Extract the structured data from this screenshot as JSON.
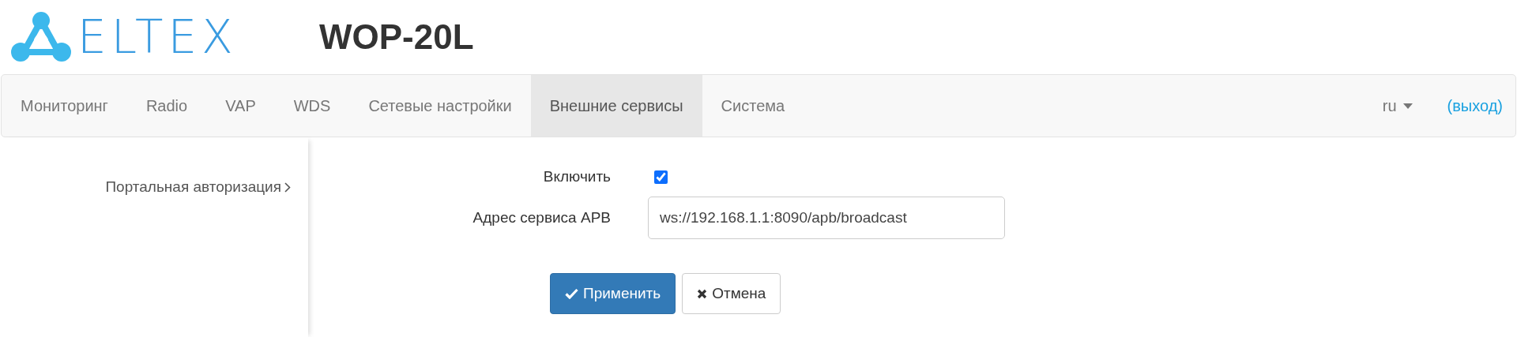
{
  "header": {
    "brand": "ELTEX",
    "model": "WOP-20L"
  },
  "nav": {
    "tabs": [
      {
        "label": "Мониторинг",
        "selected": false
      },
      {
        "label": "Radio",
        "selected": false
      },
      {
        "label": "VAP",
        "selected": false
      },
      {
        "label": "WDS",
        "selected": false
      },
      {
        "label": "Сетевые настройки",
        "selected": false
      },
      {
        "label": "Внешние сервисы",
        "selected": true
      },
      {
        "label": "Система",
        "selected": false
      }
    ],
    "language": "ru",
    "logout": "(выход)"
  },
  "sidebar": {
    "items": [
      {
        "label": "Портальная авторизация",
        "selected": true
      }
    ]
  },
  "form": {
    "fields": [
      {
        "kind": "checkbox",
        "label": "Включить",
        "checked": true
      },
      {
        "kind": "text",
        "label": "Адрес сервиса APB",
        "value": "ws://192.168.1.1:8090/apb/broadcast"
      }
    ],
    "buttons": [
      {
        "kind": "primary",
        "label": "Применить"
      },
      {
        "kind": "default",
        "label": "Отмена"
      }
    ]
  }
}
